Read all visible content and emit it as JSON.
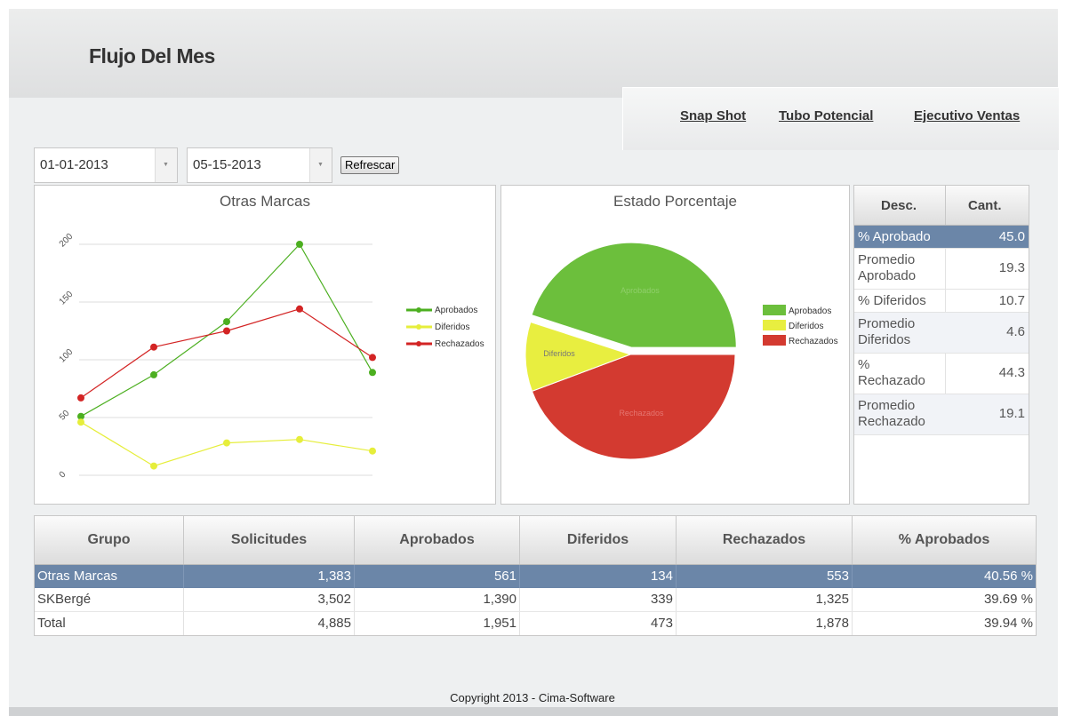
{
  "header": {
    "title": "Flujo Del Mes"
  },
  "nav": {
    "links": [
      "Snap Shot",
      "Tubo Potencial",
      "Ejecutivo Ventas"
    ]
  },
  "filters": {
    "start_date": "01-01-2013",
    "end_date": "05-15-2013",
    "refresh_label": "Refrescar"
  },
  "chart_data": [
    {
      "type": "line",
      "title": "Otras Marcas",
      "x": [
        1,
        2,
        3,
        4,
        5
      ],
      "ylim": [
        0,
        200
      ],
      "yticks": [
        "0",
        "50",
        "100",
        "150",
        "200"
      ],
      "legend_position": "right",
      "series": [
        {
          "name": "Aprobados",
          "color": "#4caf20",
          "values": [
            51,
            87,
            133,
            200,
            89
          ]
        },
        {
          "name": "Diferidos",
          "color": "#e6ee3b",
          "values": [
            46,
            8,
            28,
            31,
            21
          ]
        },
        {
          "name": "Rechazados",
          "color": "#d32424",
          "values": [
            67,
            111,
            125,
            144,
            102
          ]
        }
      ]
    },
    {
      "type": "pie",
      "title": "Estado Porcentaje",
      "legend_position": "right",
      "slices": [
        {
          "name": "Aprobados",
          "value": 45.0,
          "color": "#6cbf3c",
          "label": "Aprobados"
        },
        {
          "name": "Diferidos",
          "value": 10.7,
          "color": "#e8ee40",
          "label": "Diferidos"
        },
        {
          "name": "Rechazados",
          "value": 44.3,
          "color": "#d33a30",
          "label": "Rechazados"
        }
      ]
    }
  ],
  "summary": {
    "headers": [
      "Desc.",
      "Cant."
    ],
    "rows": [
      {
        "desc": "% Aprobado",
        "cant": "45.0"
      },
      {
        "desc": "Promedio Aprobado",
        "cant": "19.3"
      },
      {
        "desc": "% Diferidos",
        "cant": "10.7"
      },
      {
        "desc": "Promedio Diferidos",
        "cant": "4.6"
      },
      {
        "desc": "% Rechazado",
        "cant": "44.3"
      },
      {
        "desc": "Promedio Rechazado",
        "cant": "19.1"
      }
    ]
  },
  "grid": {
    "headers": [
      "Grupo",
      "Solicitudes",
      "Aprobados",
      "Diferidos",
      "Rechazados",
      "% Aprobados"
    ],
    "rows": [
      [
        "Otras Marcas",
        "1,383",
        "561",
        "134",
        "553",
        "40.56 %"
      ],
      [
        "SKBergé",
        "3,502",
        "1,390",
        "339",
        "1,325",
        "39.69 %"
      ],
      [
        "Total",
        "4,885",
        "1,951",
        "473",
        "1,878",
        "39.94 %"
      ]
    ]
  },
  "footer": {
    "copyright": "Copyright 2013 - Cima-Software"
  },
  "colors": {
    "selected_row": "#6b86a8",
    "aprobados": "#4caf20",
    "diferidos": "#e6ee3b",
    "rechazados": "#d32424"
  }
}
